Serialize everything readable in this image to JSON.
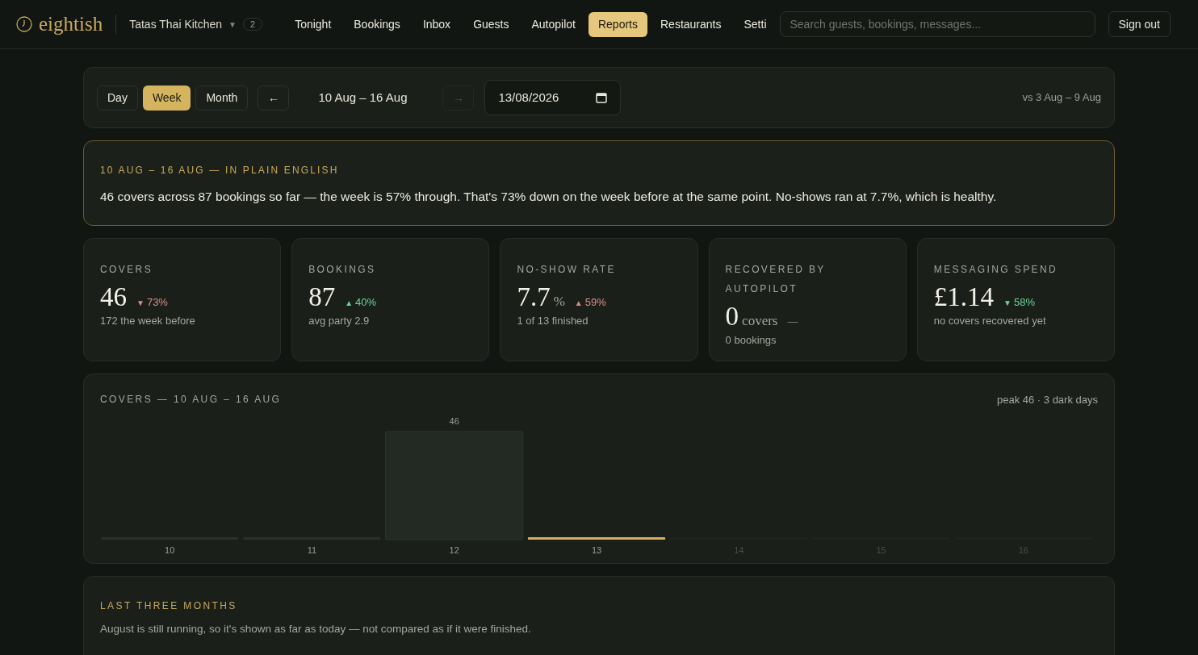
{
  "header": {
    "logo": "eightish",
    "restaurant": "Tatas Thai Kitchen",
    "caret": "▼",
    "restaurant_count": "2",
    "nav": [
      {
        "label": "Tonight",
        "selected": false
      },
      {
        "label": "Bookings",
        "selected": false
      },
      {
        "label": "Inbox",
        "selected": false
      },
      {
        "label": "Guests",
        "selected": false
      },
      {
        "label": "Autopilot",
        "selected": false
      },
      {
        "label": "Reports",
        "selected": true
      },
      {
        "label": "Restaurants",
        "selected": false
      },
      {
        "label": "Setti",
        "selected": false
      }
    ],
    "search": {
      "placeholder": "Search guests, bookings, messages..."
    },
    "sign_out": "Sign out"
  },
  "period": {
    "options": [
      {
        "label": "Day",
        "selected": false
      },
      {
        "label": "Week",
        "selected": true
      },
      {
        "label": "Month",
        "selected": false
      }
    ],
    "prev": "←",
    "range": "10 Aug – 16 Aug",
    "next": "→",
    "next_disabled": true,
    "date": "13/08/2026",
    "compare": "vs 3 Aug – 9 Aug"
  },
  "summary": {
    "title": "10 AUG – 16 AUG — IN PLAIN ENGLISH",
    "text": "46 covers across 87 bookings so far — the week is 57% through. That's 73% down on the week before at the same point. No-shows ran at 7.7%, which is healthy."
  },
  "stats": [
    {
      "label": "COVERS",
      "value": "46",
      "arrow": "▼",
      "change": "73%",
      "good": false,
      "note": "172 the week before"
    },
    {
      "label": "BOOKINGS",
      "value": "87",
      "arrow": "▲",
      "change": "40%",
      "good": true,
      "note": "avg party 2.9"
    },
    {
      "label": "NO-SHOW RATE",
      "value": "7.7",
      "unit": "%",
      "arrow": "▲",
      "change": "59%",
      "good": false,
      "note": "1 of 13 finished"
    },
    {
      "label": "RECOVERED BY AUTOPILOT",
      "value": "0",
      "unit": "covers",
      "change": "—",
      "note": "0 bookings"
    },
    {
      "label": "MESSAGING SPEND",
      "value": "£1.14",
      "arrow": "▼",
      "change": "58%",
      "good": true,
      "note": "no covers recovered yet"
    }
  ],
  "chart_card": {
    "title": "COVERS — 10 AUG – 16 AUG",
    "meta": "peak 46 · 3 dark days",
    "days": [
      {
        "label": "10",
        "kind": "empty"
      },
      {
        "label": "11",
        "kind": "empty"
      },
      {
        "label": "12",
        "kind": "peak",
        "value": "46"
      },
      {
        "label": "13",
        "kind": "today"
      },
      {
        "label": "14",
        "kind": "future"
      },
      {
        "label": "15",
        "kind": "future"
      },
      {
        "label": "16",
        "kind": "future"
      }
    ]
  },
  "months": {
    "title": "LAST THREE MONTHS",
    "text": "August is still running, so it's shown as far as today — not compared as if it were finished."
  }
}
